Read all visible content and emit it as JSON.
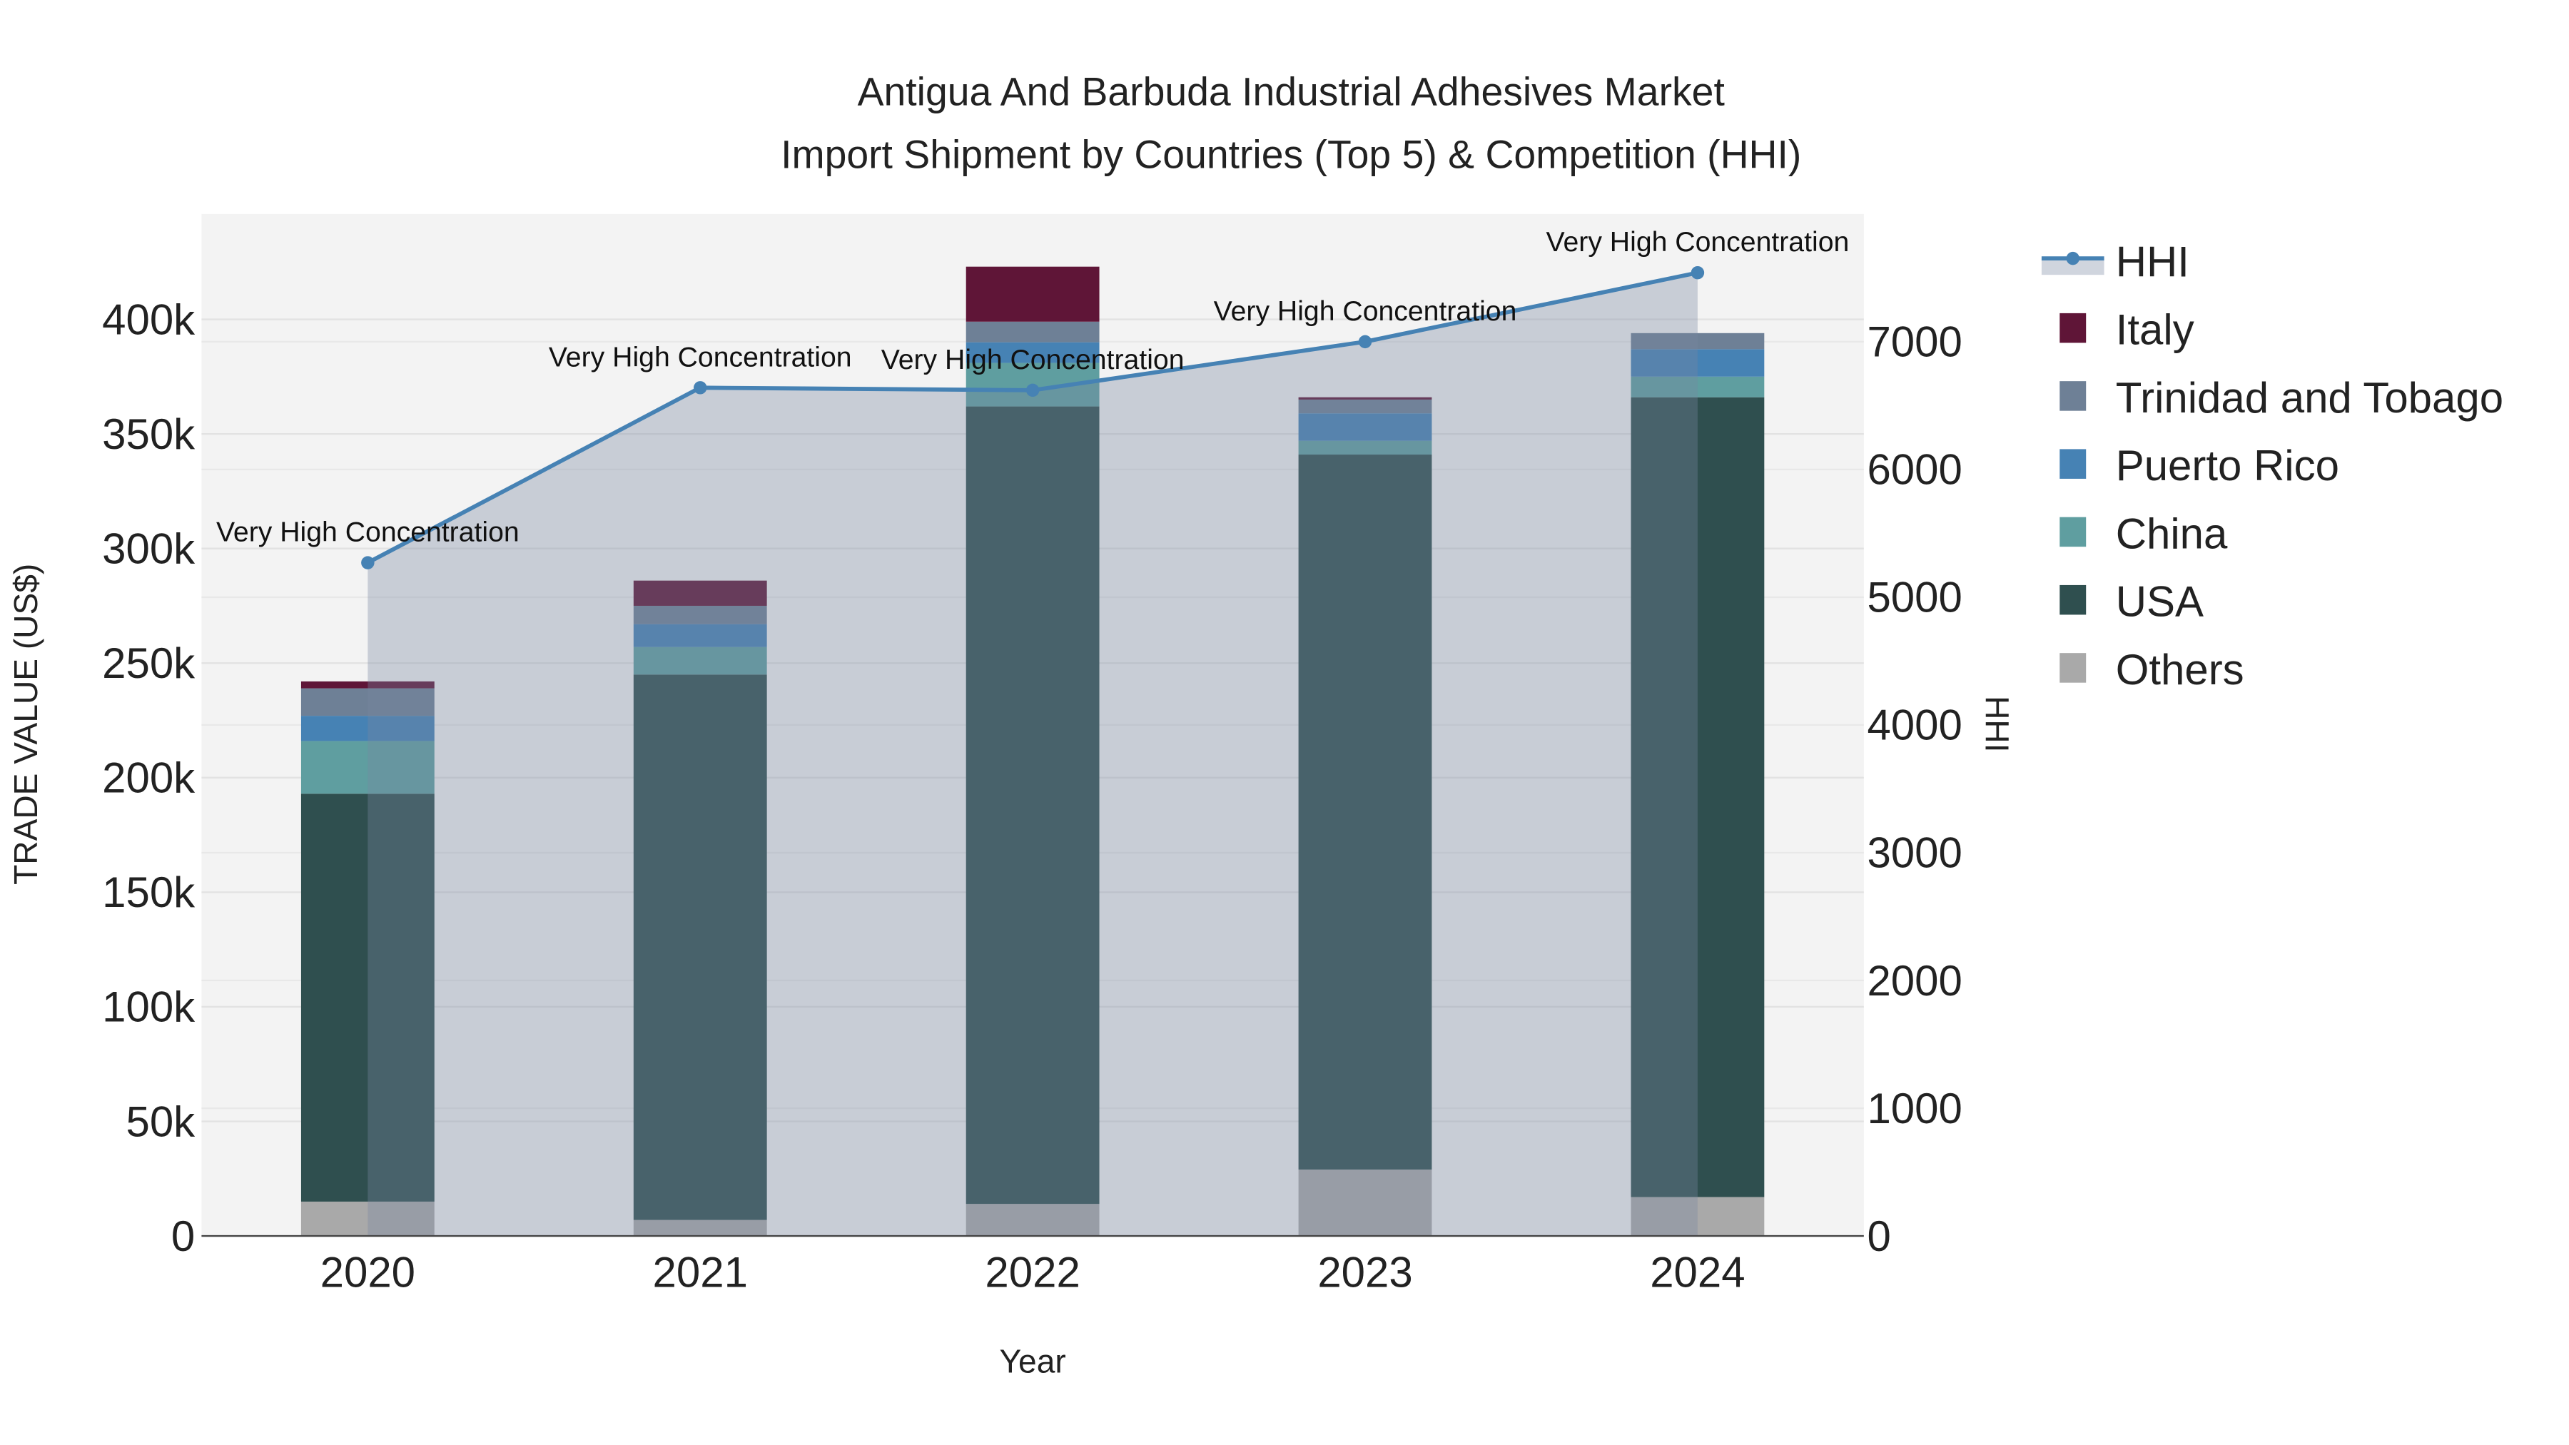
{
  "chart_data": {
    "type": "bar",
    "title_line1": "Antigua And Barbuda Industrial Adhesives Market",
    "title_line2": "Import Shipment by Countries (Top 5) & Competition (HHI)",
    "xlabel": "Year",
    "ylabel": "TRADE VALUE (US$)",
    "y2label": "HHI",
    "categories": [
      "2020",
      "2021",
      "2022",
      "2023",
      "2024"
    ],
    "ylim": [
      0,
      446000
    ],
    "y2lim": [
      0,
      8000
    ],
    "yticks": [
      0,
      50000,
      100000,
      150000,
      200000,
      250000,
      300000,
      350000,
      400000
    ],
    "ytick_labels": [
      "0",
      "50k",
      "100k",
      "150k",
      "200k",
      "250k",
      "300k",
      "350k",
      "400k"
    ],
    "y2ticks": [
      0,
      1000,
      2000,
      3000,
      4000,
      5000,
      6000,
      7000
    ],
    "y2tick_labels": [
      "0",
      "1000",
      "2000",
      "3000",
      "4000",
      "5000",
      "6000",
      "7000"
    ],
    "series": [
      {
        "name": "Others",
        "color": "#a9a9a9",
        "values": [
          15000,
          7000,
          14000,
          29000,
          17000
        ]
      },
      {
        "name": "USA",
        "color": "#2f4f4f",
        "values": [
          178000,
          238000,
          348000,
          312000,
          349000
        ]
      },
      {
        "name": "China",
        "color": "#5f9ea0",
        "values": [
          23000,
          12000,
          19000,
          6000,
          9000
        ]
      },
      {
        "name": "Puerto Rico",
        "color": "#4682b4",
        "values": [
          11000,
          10000,
          9000,
          12000,
          12000
        ]
      },
      {
        "name": "Trinidad and Tobago",
        "color": "#6e8096",
        "values": [
          12000,
          8000,
          9000,
          6000,
          7000
        ]
      },
      {
        "name": "Italy",
        "color": "#5f1537",
        "values": [
          3000,
          11000,
          24000,
          1000,
          0
        ]
      }
    ],
    "hhi": {
      "name": "HHI",
      "color": "#4682b4",
      "values": [
        5270,
        6640,
        6620,
        7000,
        7540
      ],
      "annotations": [
        "Very High Concentration",
        "Very High Concentration",
        "Very High Concentration",
        "Very High Concentration",
        "Very High Concentration"
      ]
    },
    "legend": [
      "HHI",
      "Italy",
      "Trinidad and Tobago",
      "Puerto Rico",
      "China",
      "USA",
      "Others"
    ],
    "legend_placement": "right",
    "grid": true
  }
}
